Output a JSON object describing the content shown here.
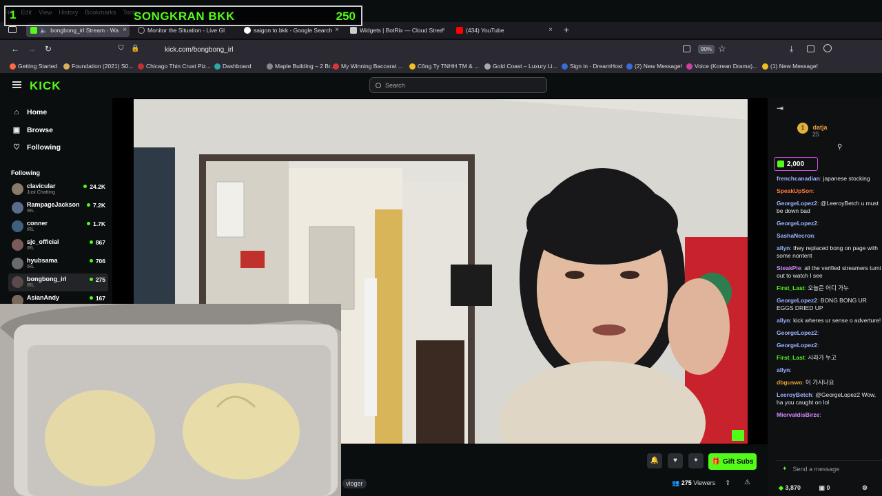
{
  "menubar": [
    "File",
    "Edit",
    "View",
    "History",
    "Bookmarks",
    "Tools"
  ],
  "overlay": {
    "number": "1",
    "title": "SONGKRAN BKK",
    "count": "250"
  },
  "tabs": [
    {
      "label": "bongbong_irl Stream - Wa",
      "active": true
    },
    {
      "label": "Monitor the Situation - Live Gl"
    },
    {
      "label": "saigon to bkk - Google Search"
    },
    {
      "label": "Widgets | BotRix — Cloud Strea"
    },
    {
      "label": "(434) YouTube"
    }
  ],
  "navbar": {
    "url": "kick.com/bongbong_irl",
    "zoom": "90%"
  },
  "bookmarks": [
    "Getting Started",
    "Foundation (2021) S0...",
    "Chicago Thin Crust Piz...",
    "Dashboard",
    "Maple Building – 2 Br...",
    "My Winning Baccarat ...",
    "Công Ty TNHH TM & ...",
    "Gold Coast – Luxury Li...",
    "Sign in · DreamHost",
    "(2) New Message!",
    "Voice (Korean Drama)...",
    "(1) New Message!"
  ],
  "kick": {
    "logo": "KICK",
    "search_placeholder": "Search"
  },
  "sidebar": {
    "nav": [
      {
        "label": "Home",
        "icon": "home-icon"
      },
      {
        "label": "Browse",
        "icon": "browse-icon"
      },
      {
        "label": "Following",
        "icon": "heart-icon"
      }
    ],
    "following_header": "Following",
    "following": [
      {
        "name": "clavicular",
        "category": "Just Chatting",
        "viewers": "24.2K",
        "color": "#8a7a6a"
      },
      {
        "name": "RampageJackson",
        "category": "IRL",
        "viewers": "7.2K",
        "color": "#5b6b8c"
      },
      {
        "name": "conner",
        "category": "IRL",
        "viewers": "1.7K",
        "color": "#3f5f7f"
      },
      {
        "name": "sjc_official",
        "category": "IRL",
        "viewers": "867",
        "color": "#7a5a5a"
      },
      {
        "name": "hyubsama",
        "category": "IRL",
        "viewers": "706",
        "color": "#6a6a6a"
      },
      {
        "name": "bongbong_irl",
        "category": "IRL",
        "viewers": "275",
        "color": "#5a4a4a",
        "selected": true
      },
      {
        "name": "AsianAndy",
        "category": "",
        "viewers": "167",
        "color": "#7a6a5a"
      }
    ]
  },
  "player": {
    "tag": "vloger",
    "gift_label": "Gift Subs",
    "viewers": "275",
    "viewers_label": "Viewers"
  },
  "chat": {
    "leader": {
      "rank": "1",
      "name": "datja",
      "value": "25"
    },
    "pill_value": "2,000",
    "messages": [
      {
        "user": "frenchcanadian",
        "text": "japanese stocking",
        "color": "#9fb4ff"
      },
      {
        "user": "SpeakUpSon",
        "text": "",
        "color": "#ff7a3d"
      },
      {
        "user": "GeorgeLopez2",
        "text": "@LeeroyBetch u must be down bad",
        "color": "#9fb4ff"
      },
      {
        "user": "GeorgeLopez2",
        "text": "",
        "color": "#9fb4ff"
      },
      {
        "user": "SashaNecron",
        "text": "",
        "color": "#9fb4ff"
      },
      {
        "user": "allyn",
        "text": "they replaced bong on page with some nontent",
        "color": "#9fb4ff"
      },
      {
        "user": "SteakPie",
        "text": "all the verified streamers turni out to watch I see",
        "color": "#d58bff"
      },
      {
        "user": "First_Last",
        "text": "오늘은 어디 가누",
        "color": "#53fc18"
      },
      {
        "user": "GeorgeLopez2",
        "text": "BONG BONG UR EGGS DRIED UP",
        "color": "#9fb4ff"
      },
      {
        "user": "allyn",
        "text": "kick wheres ur sense o adverture!",
        "color": "#9fb4ff"
      },
      {
        "user": "GeorgeLopez2",
        "text": "",
        "color": "#9fb4ff"
      },
      {
        "user": "GeorgeLopez2",
        "text": "",
        "color": "#9fb4ff"
      },
      {
        "user": "First_Last",
        "text": "시라가 누고",
        "color": "#53fc18"
      },
      {
        "user": "allyn",
        "text": "",
        "color": "#9fb4ff"
      },
      {
        "user": "dbguswo",
        "text": "어 가시나요",
        "color": "#e8a13a"
      },
      {
        "user": "LeeroyBetch",
        "text": "@GeorgeLopez2 Wow, ha you caught on lol",
        "color": "#9fb4ff"
      },
      {
        "user": "MiervaldisBirze",
        "text": "",
        "color": "#d58bff"
      }
    ],
    "send_placeholder": "Send a message",
    "footer_points": "3,870",
    "footer_count": "0"
  }
}
